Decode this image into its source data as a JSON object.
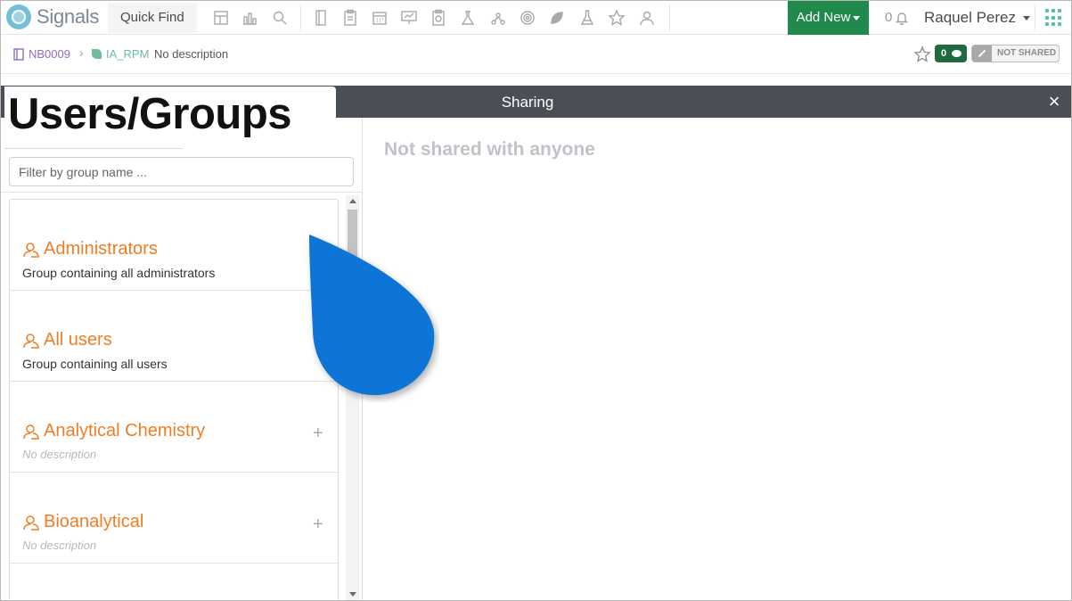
{
  "app": {
    "name": "Signals"
  },
  "topnav": {
    "quick_find": "Quick Find",
    "add_new": "Add New",
    "notifications_count": "0",
    "user_name": "Raquel Perez"
  },
  "breadcrumb": {
    "notebook": "NB0009",
    "experiment": "IA_RPM",
    "description": "No description",
    "comments_count": "0",
    "share_status": "NOT SHARED"
  },
  "sharing": {
    "title": "Sharing",
    "close_label": "×",
    "overlay_label": "Users/Groups",
    "filter_placeholder": "Filter by group name ...",
    "empty_message": "Not shared with anyone",
    "groups": [
      {
        "name": "Administrators",
        "description": "Group containing all administrators",
        "has_description": true,
        "addable": false
      },
      {
        "name": "All users",
        "description": "Group containing all users",
        "has_description": true,
        "addable": false
      },
      {
        "name": "Analytical Chemistry",
        "description": "No description",
        "has_description": false,
        "addable": true
      },
      {
        "name": "Bioanalytical",
        "description": "No description",
        "has_description": false,
        "addable": true
      }
    ],
    "plus_label": "+"
  },
  "colors": {
    "accent_green": "#1f8a4c",
    "group_orange": "#f07c23",
    "sharing_bar": "#4a4f55",
    "notebook_purple": "#8b6fc2",
    "pointer_blue": "#0a74d6"
  }
}
